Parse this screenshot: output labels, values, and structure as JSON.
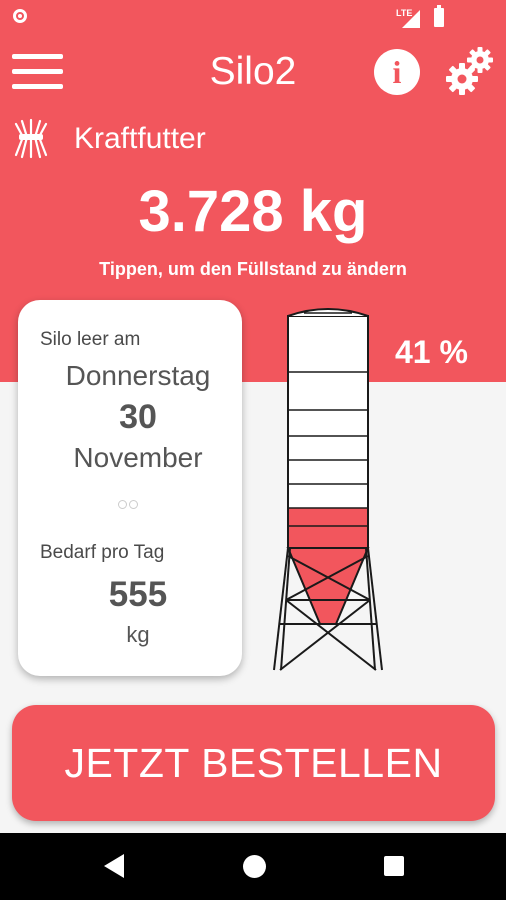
{
  "app": {
    "title": "Silo2"
  },
  "feed": {
    "label": "Kraftfutter"
  },
  "fill": {
    "amount": "3.728 kg",
    "hint": "Tippen, um den Füllstand zu ändern",
    "percent": "41 %",
    "level": 0.41
  },
  "card": {
    "empty_label": "Silo leer am",
    "weekday": "Donnerstag",
    "day": "30",
    "month": "November",
    "demand_label": "Bedarf pro Tag",
    "demand_value": "555",
    "demand_unit": "kg"
  },
  "order": {
    "button_label": "JETZT BESTELLEN"
  },
  "status_bar": {
    "network": "LTE"
  },
  "colors": {
    "accent": "#f2565d",
    "background": "#f5f5f5",
    "card": "#ffffff",
    "nav": "#000000"
  },
  "icons": {
    "menu": "menu-icon",
    "info": "info-icon",
    "settings": "gear-icon",
    "feed": "wheat-sheaf-icon",
    "back": "back-icon",
    "home": "home-icon",
    "recent": "recent-apps-icon"
  }
}
